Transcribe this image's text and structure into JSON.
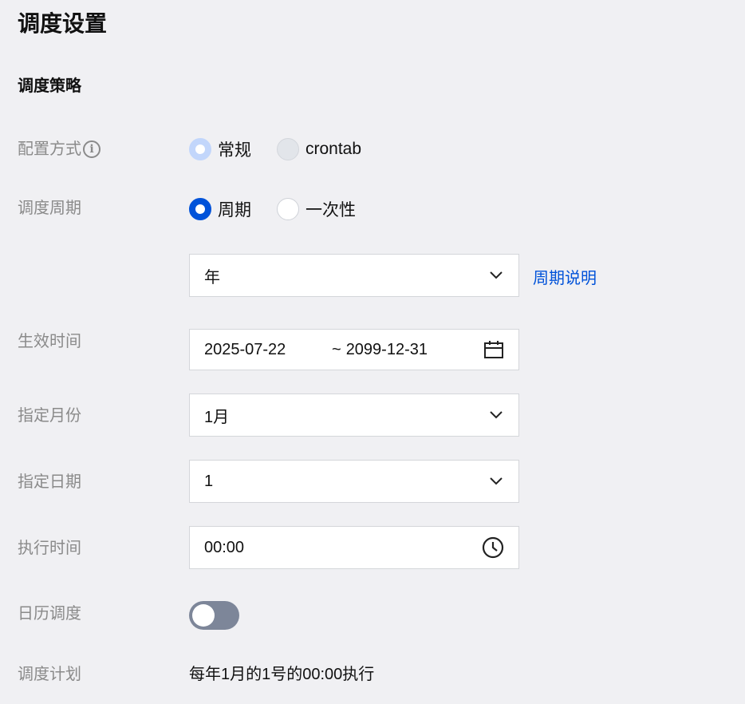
{
  "page_title": "调度设置",
  "section_title": "调度策略",
  "config_mode": {
    "label": "配置方式",
    "options": [
      {
        "label": "常规",
        "selected": true
      },
      {
        "label": "crontab",
        "selected": false
      }
    ]
  },
  "schedule_cycle": {
    "label": "调度周期",
    "options": [
      {
        "label": "周期",
        "selected": true
      },
      {
        "label": "一次性",
        "selected": false
      }
    ],
    "cycle_select_value": "年",
    "cycle_help_link": "周期说明"
  },
  "effective_time": {
    "label": "生效时间",
    "start": "2025-07-22",
    "separator": "~",
    "end": "2099-12-31"
  },
  "specified_month": {
    "label": "指定月份",
    "value": "1月"
  },
  "specified_date": {
    "label": "指定日期",
    "value": "1"
  },
  "execution_time": {
    "label": "执行时间",
    "value": "00:00"
  },
  "calendar_schedule": {
    "label": "日历调度",
    "enabled": false
  },
  "schedule_plan": {
    "label": "调度计划",
    "text": "每年1月的1号的00:00执行"
  },
  "colors": {
    "primary": "#0052d9",
    "toggle_off": "#7d8699",
    "label_gray": "#8a8a8a",
    "background": "#f0f0f3"
  }
}
